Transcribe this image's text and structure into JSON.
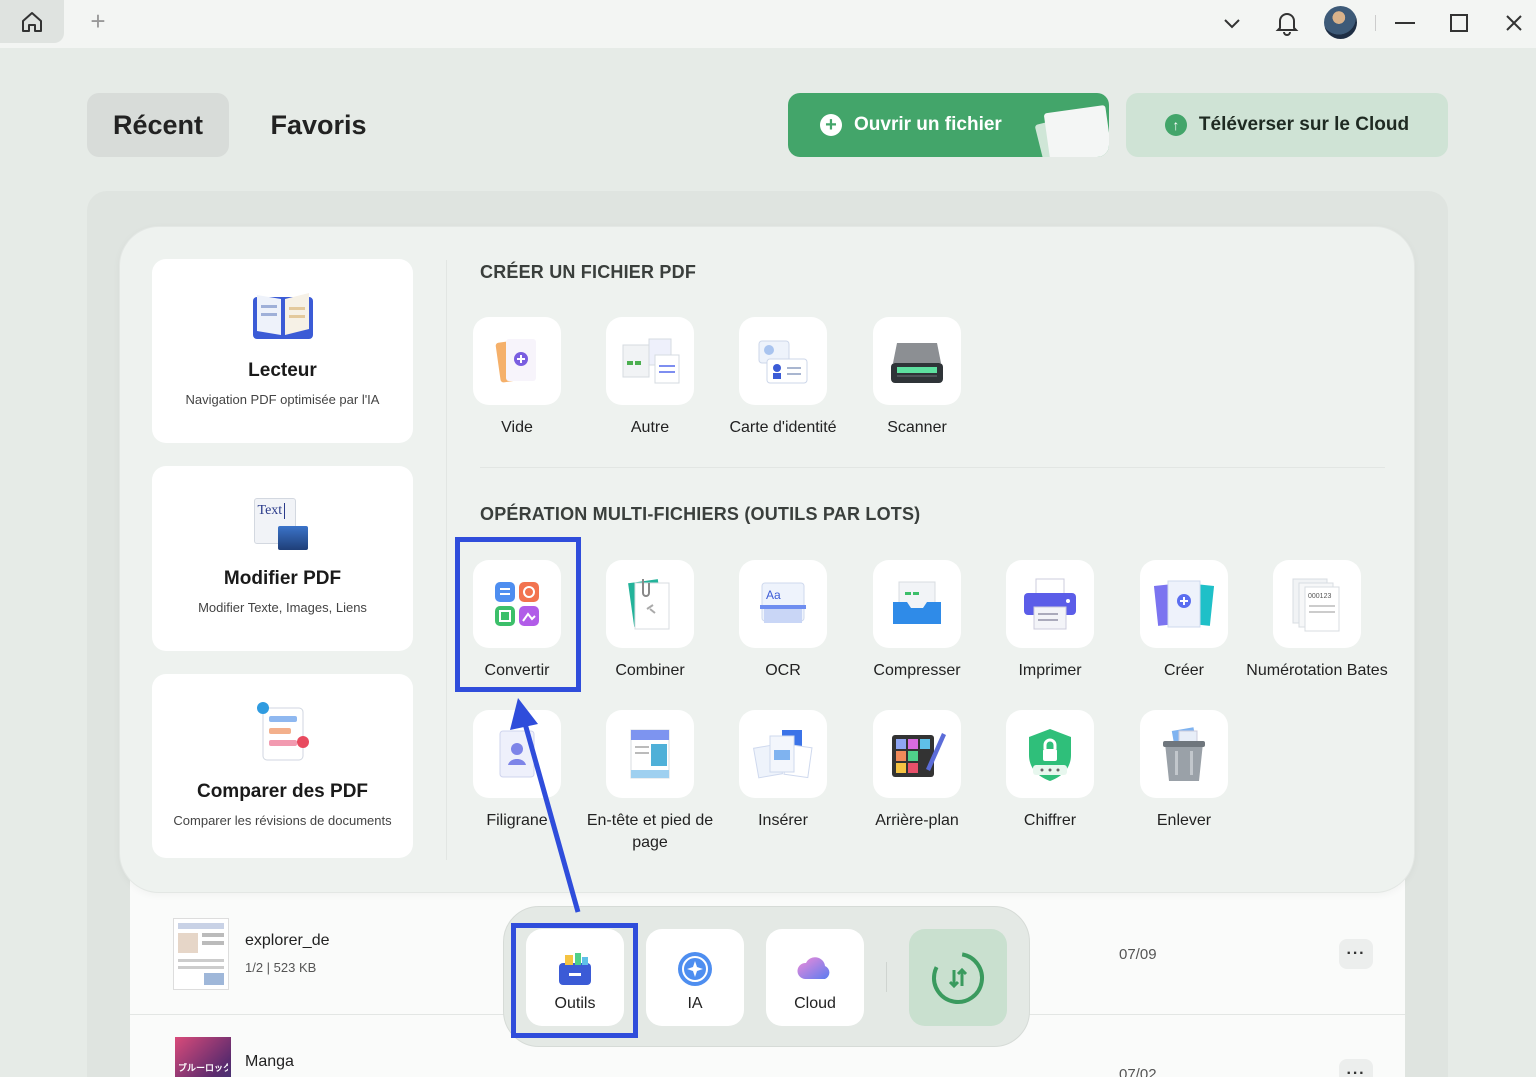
{
  "tabs": {
    "recent": "Récent",
    "favorites": "Favoris"
  },
  "actions": {
    "open_file": "Ouvrir un fichier",
    "upload_cloud": "Téléverser sur le Cloud"
  },
  "side_cards": [
    {
      "title": "Lecteur",
      "subtitle": "Navigation PDF optimisée par l'IA"
    },
    {
      "title": "Modifier PDF",
      "subtitle": "Modifier Texte, Images, Liens",
      "icon_text": "Text"
    },
    {
      "title": "Comparer des PDF",
      "subtitle": "Comparer les révisions de documents"
    }
  ],
  "sections": {
    "create": "CRÉER UN FICHIER PDF",
    "batch": "OPÉRATION MULTI-FICHIERS (OUTILS PAR LOTS)"
  },
  "create_tools": [
    "Vide",
    "Autre",
    "Carte d'identité",
    "Scanner"
  ],
  "batch_tools": [
    "Convertir",
    "Combiner",
    "OCR",
    "Compresser",
    "Imprimer",
    "Créer",
    "Numérotation Bates",
    "Filigrane",
    "En-tête et pied de page",
    "Insérer",
    "Arrière-plan",
    "Chiffrer",
    "Enlever"
  ],
  "icon_texts": {
    "ocr": "Aa",
    "bates": "000123"
  },
  "files": [
    {
      "name": "explorer_de",
      "meta": "1/2 | 523 KB",
      "date": "07/09"
    },
    {
      "name": "Manga",
      "date": "07/02",
      "thumb_text": "ブルーロック"
    }
  ],
  "dock": {
    "tools": "Outils",
    "ai": "IA",
    "cloud": "Cloud"
  },
  "colors": {
    "accent": "#43a56a",
    "highlight": "#2f4ddb"
  }
}
